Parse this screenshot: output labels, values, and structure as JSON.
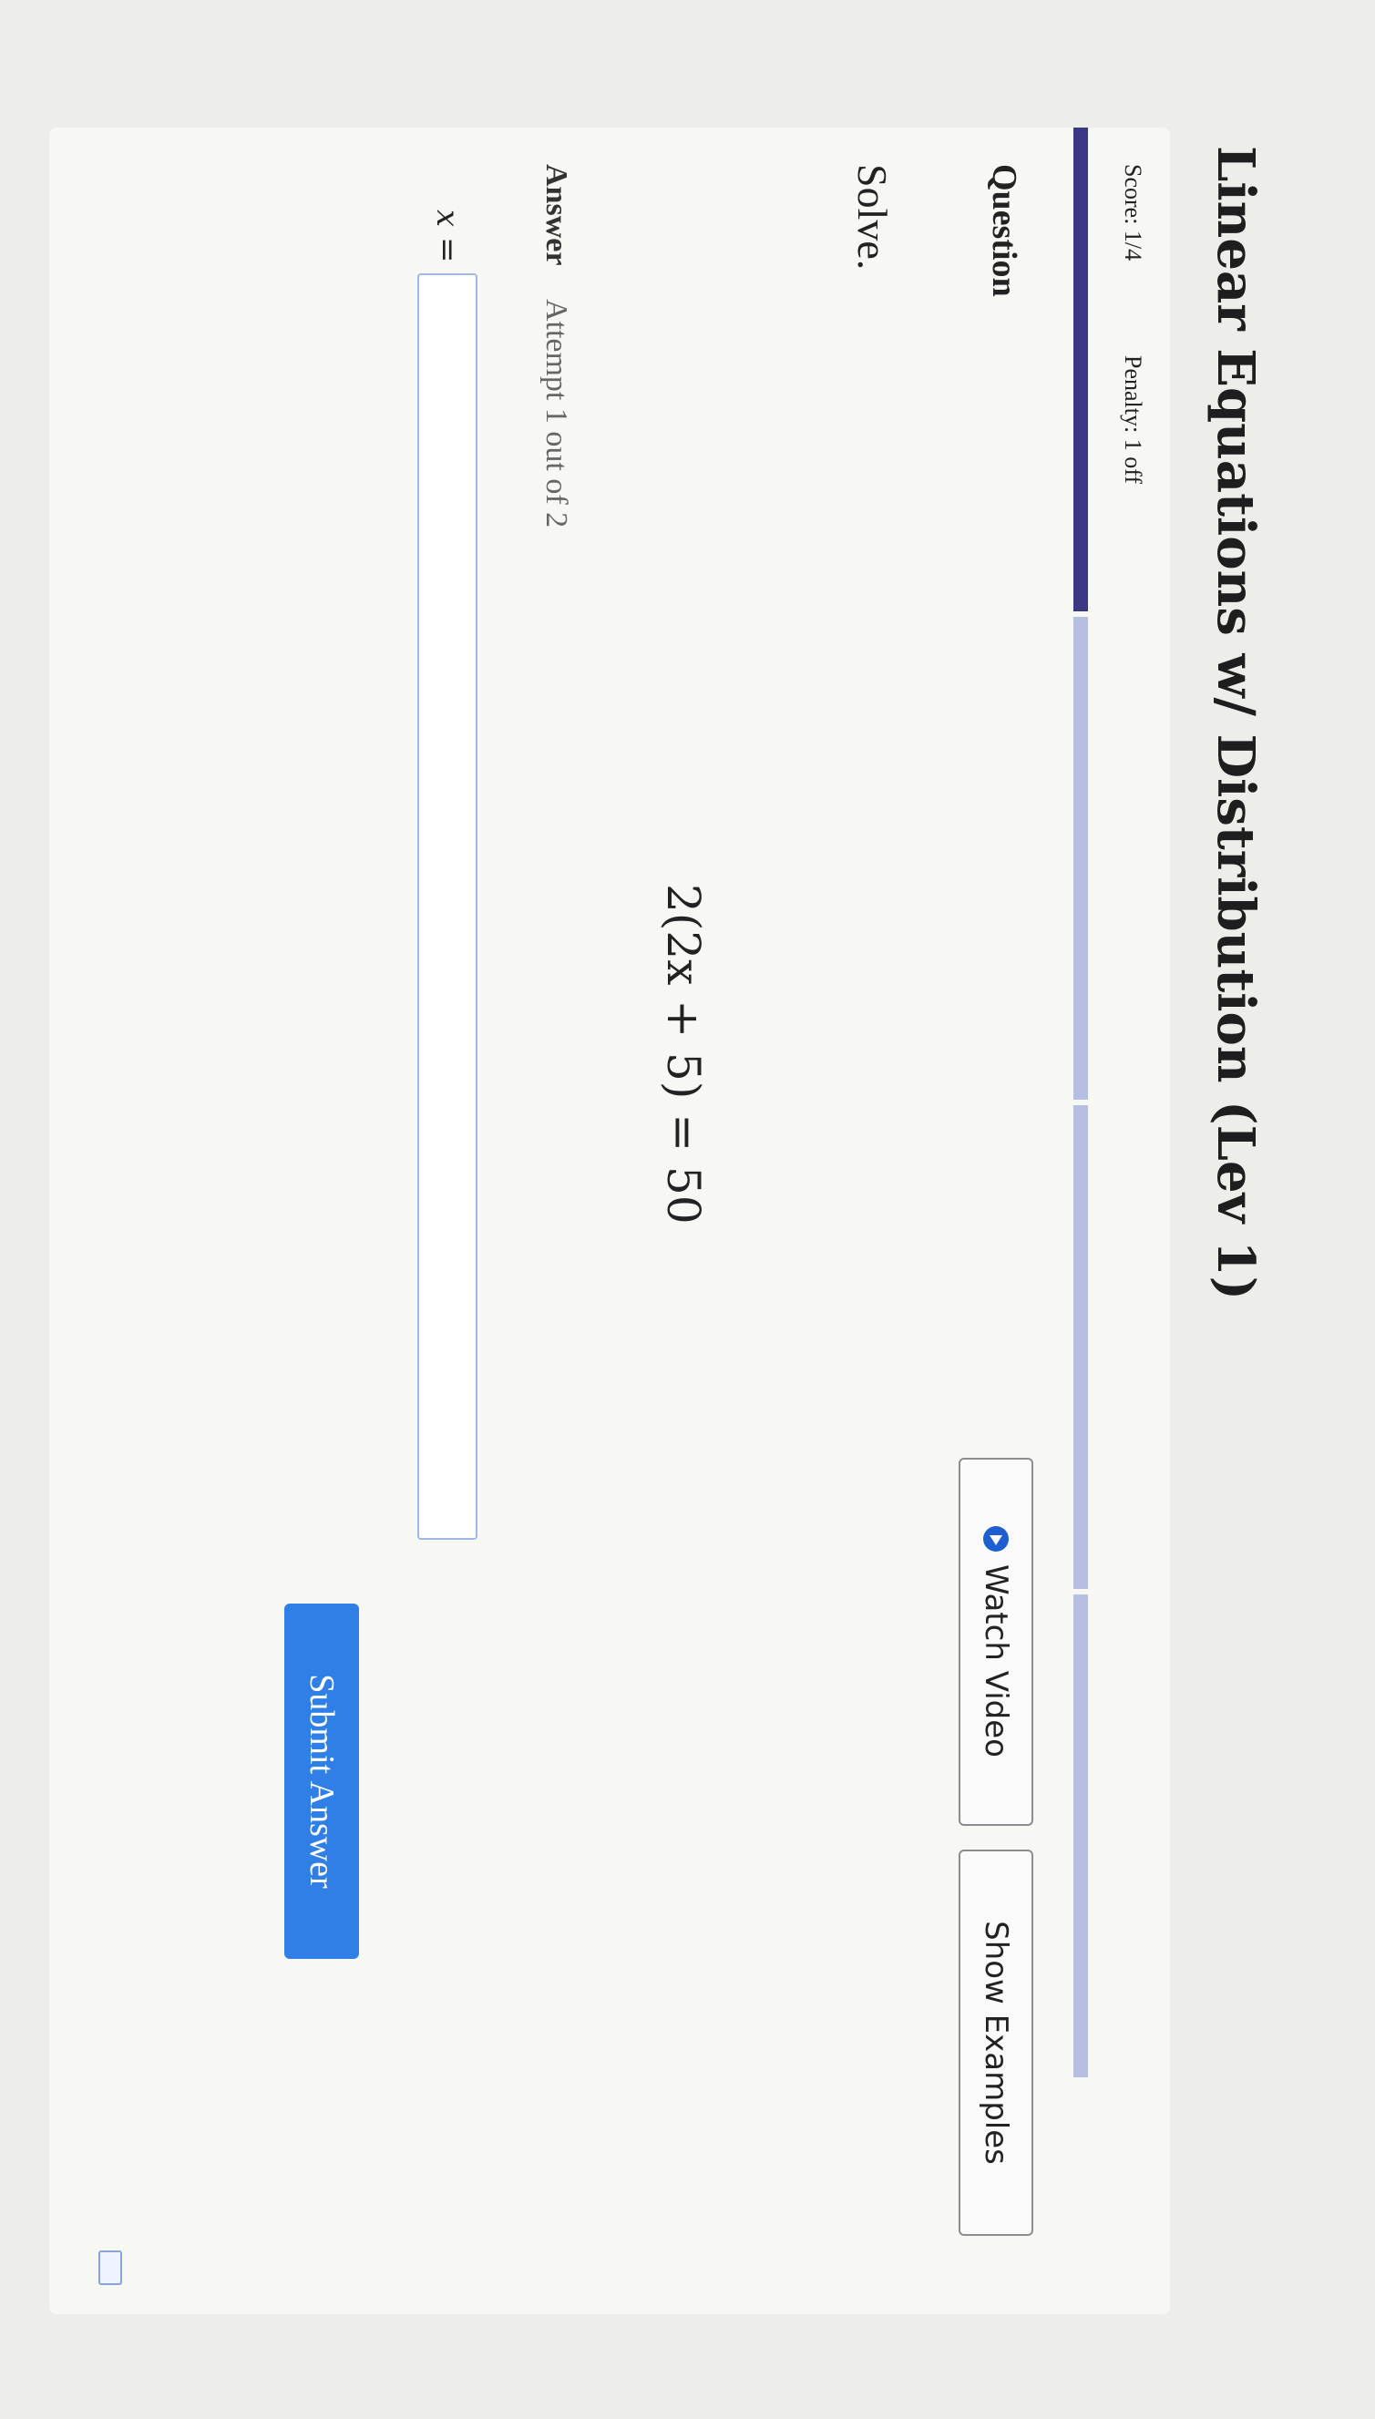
{
  "page": {
    "title": "Linear Equations w/ Distribution (Lev 1)"
  },
  "status": {
    "score": "Score: 1/4",
    "penalty": "Penalty: 1 off",
    "progress_segments_total": 4,
    "progress_segments_filled": 1
  },
  "question": {
    "heading": "Question",
    "instruction": "Solve.",
    "equation": "2(2x + 5) = 50",
    "watch_video_label": "Watch Video",
    "show_examples_label": "Show Examples"
  },
  "answer": {
    "heading": "Answer",
    "attempt": "Attempt 1 out of 2",
    "variable": "x =",
    "input_value": "",
    "submit_label": "Submit Answer"
  },
  "icons": {
    "video": "play-circle-icon",
    "keyboard": "keyboard-icon"
  },
  "colors": {
    "progress_filled": "#3b3785",
    "progress_empty": "#b6bfe2",
    "submit": "#2f7fe6",
    "play_icon": "#1d5fd0"
  }
}
